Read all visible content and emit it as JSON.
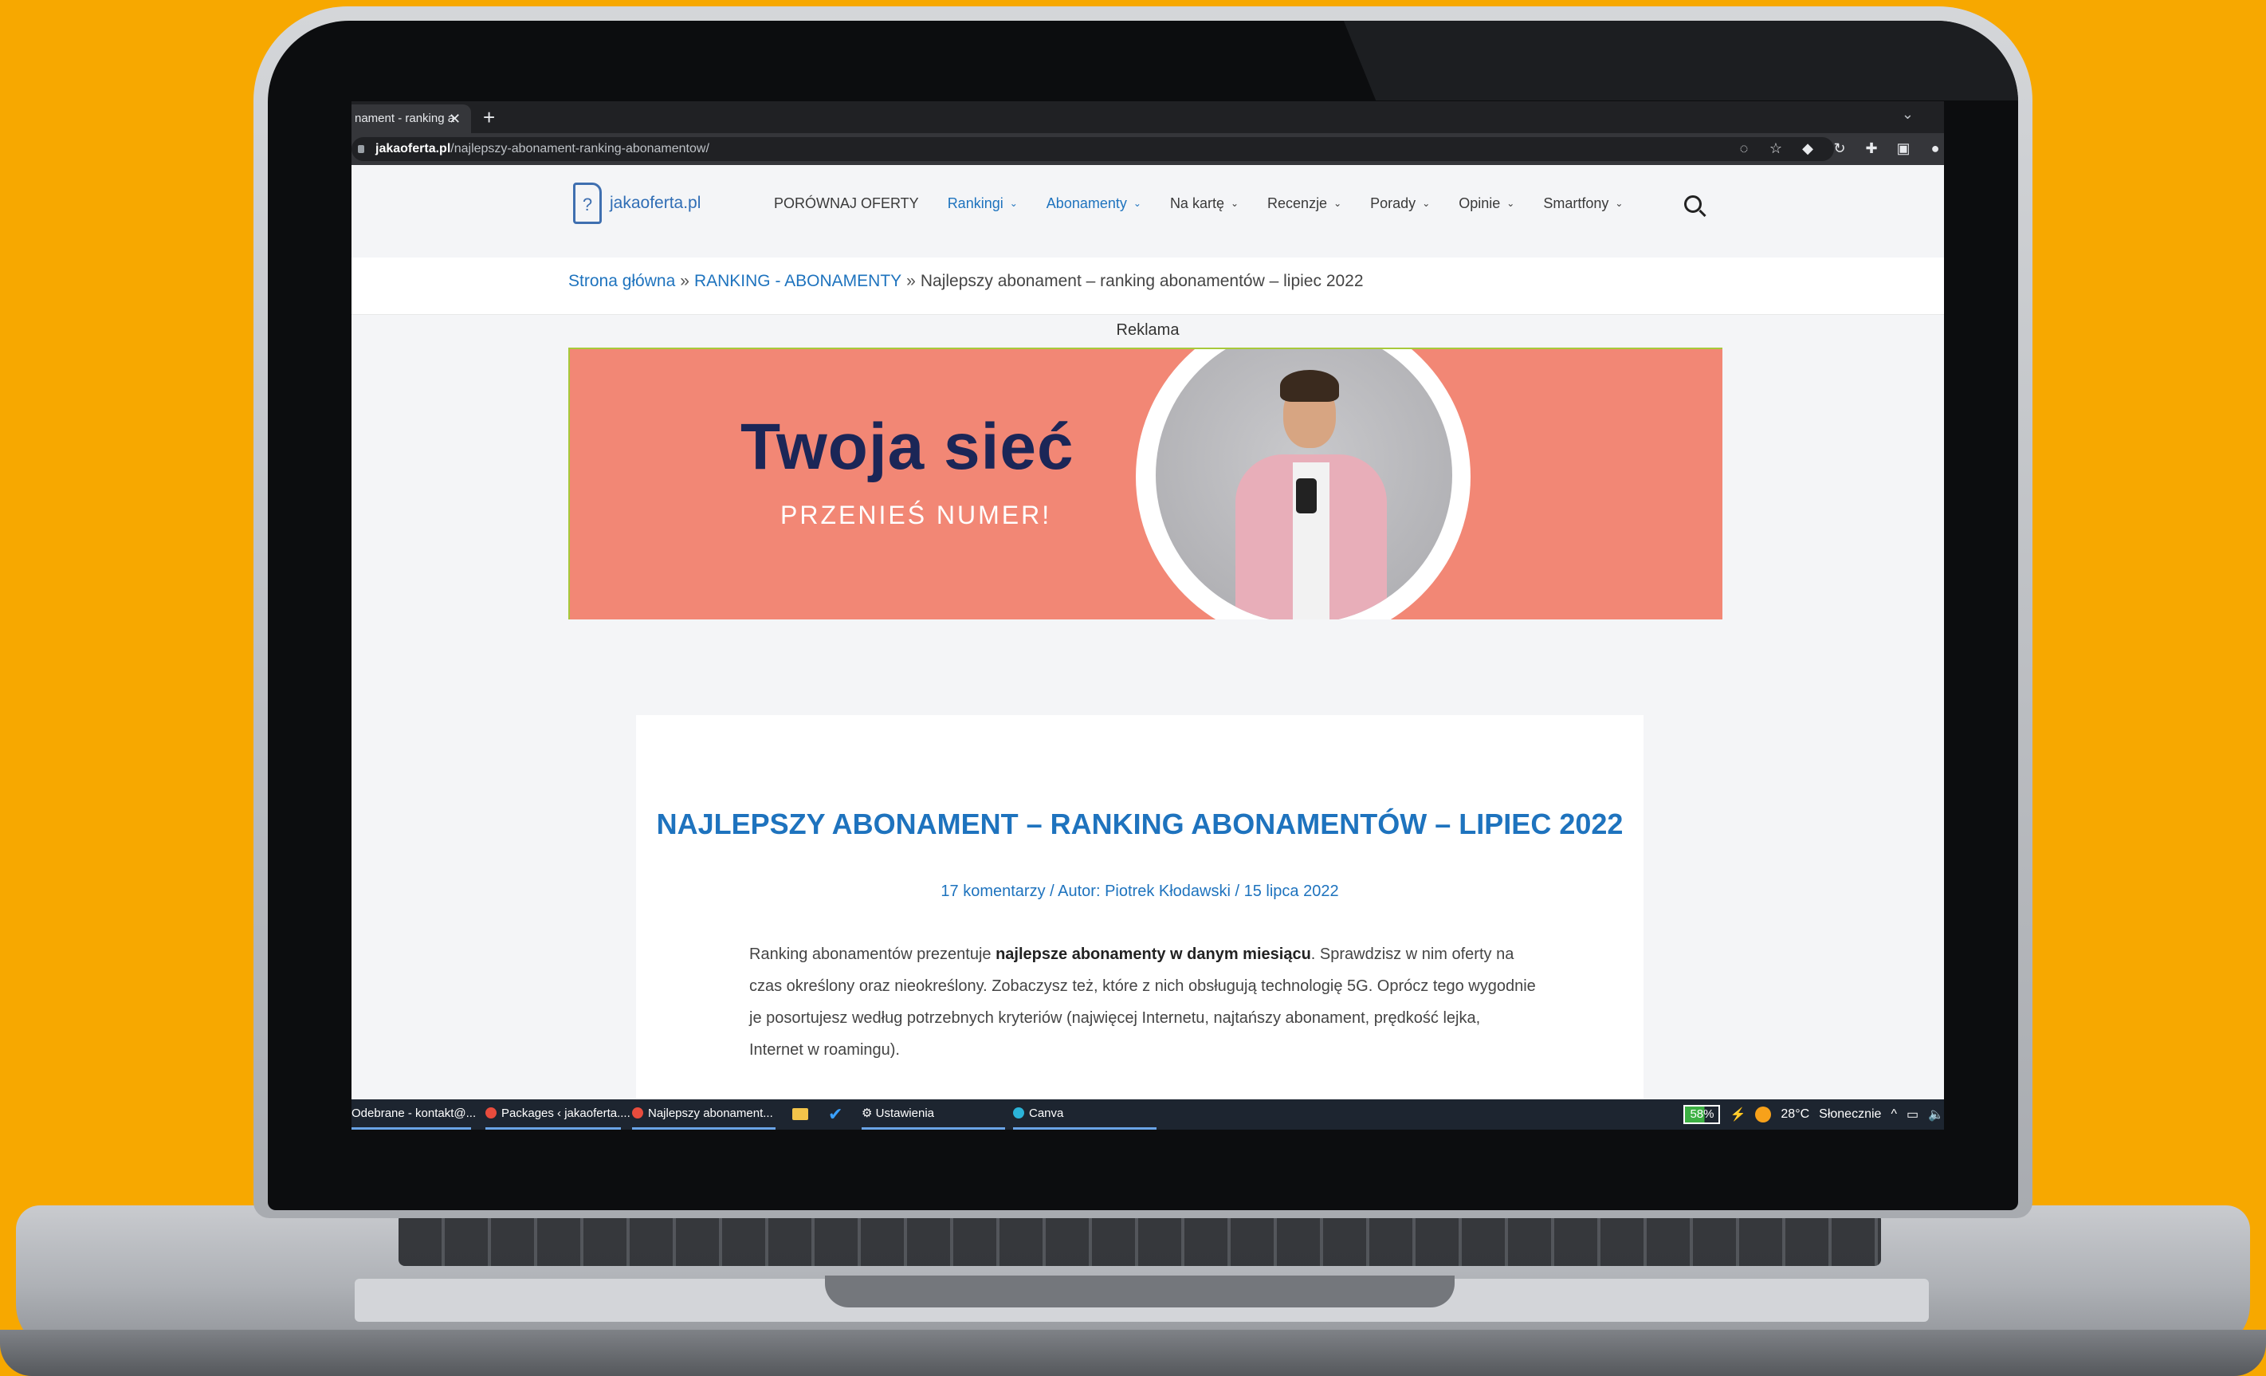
{
  "browser": {
    "tab_title": "nament - ranking a",
    "close_glyph": "✕",
    "new_tab_glyph": "+",
    "tab_menu_glyph": "⌄",
    "url_domain": "jakaoferta.pl",
    "url_path": "/najlepszy-abonament-ranking-abonamentow/"
  },
  "site": {
    "logo_glyph": "?",
    "logo_text": "jakaoferta.pl",
    "nav": [
      {
        "label": "PORÓWNAJ OFERTY"
      },
      {
        "label": "Rankingi",
        "chevron": "⌄"
      },
      {
        "label": "Abonamenty",
        "chevron": "⌄"
      },
      {
        "label": "Na kartę",
        "chevron": "⌄"
      },
      {
        "label": "Recenzje",
        "chevron": "⌄"
      },
      {
        "label": "Porady",
        "chevron": "⌄"
      },
      {
        "label": "Opinie",
        "chevron": "⌄"
      },
      {
        "label": "Smartfony",
        "chevron": "⌄"
      }
    ],
    "breadcrumb": {
      "home": "Strona główna",
      "sep": "»",
      "section": "RANKING - ABONAMENTY",
      "current": "Najlepszy abonament – ranking abonamentów – lipiec 2022"
    }
  },
  "ad": {
    "label": "Reklama",
    "title": "Twoja sieć",
    "subtitle": "PRZENIEŚ NUMER!"
  },
  "article": {
    "title": "NAJLEPSZY ABONAMENT – RANKING ABONAMENTÓW – LIPIEC 2022",
    "meta": "17 komentarzy / Autor: Piotrek Kłodawski / 15 lipca 2022",
    "intro_pre": "Ranking abonamentów prezentuje ",
    "intro_bold": "najlepsze abonamenty w danym miesiącu",
    "intro_post": ". Sprawdzisz w nim oferty na czas określony oraz nieokreślony. Zobaczysz też, które z nich obsługują technologię 5G. Oprócz tego wygodnie je posortujesz według potrzebnych kryteriów (najwięcej Internetu, najtańszy abonament, prędkość lejka, Internet w roamingu)."
  },
  "taskbar": {
    "items": [
      {
        "label": "Odebrane - kontakt@..."
      },
      {
        "label": "Packages ‹ jakaoferta...."
      },
      {
        "label": "Najlepszy abonament..."
      },
      {
        "label": "Ustawienia"
      },
      {
        "label": "Canva"
      }
    ],
    "battery": "58%",
    "weather_temp": "28°C",
    "weather_desc": "Słonecznie",
    "tray_caret": "^"
  },
  "colors": {
    "background": "#f7a800",
    "link": "#1e73be",
    "ad_bg": "#f28775",
    "ad_title": "#1b2657"
  }
}
